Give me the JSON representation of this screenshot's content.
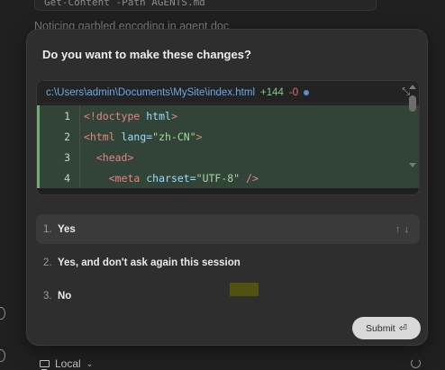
{
  "background": {
    "command_text": "Get-Content -Path AGENTS.md",
    "note_text": "Noticing garbled encoding in agent doc"
  },
  "dialog": {
    "title": "Do you want to make these changes?",
    "file": {
      "path": "c:\\Users\\admin\\Documents\\MySite\\index.html",
      "additions": "+144",
      "deletions": "-0"
    },
    "code_lines": [
      {
        "num": "1",
        "tag_open": "<!doctype",
        "attr": " html",
        "str": "",
        "close": ">",
        "indent": ""
      },
      {
        "num": "2",
        "tag_open": "<html",
        "attr": " lang=",
        "str": "\"zh-CN\"",
        "close": ">",
        "indent": ""
      },
      {
        "num": "3",
        "tag_open": "<head",
        "attr": "",
        "str": "",
        "close": ">",
        "indent": "  "
      },
      {
        "num": "4",
        "tag_open": "<meta",
        "attr": " charset=",
        "str": "\"UTF-8\"",
        "close": " />",
        "indent": "    "
      }
    ],
    "options": [
      {
        "number": "1.",
        "label": "Yes",
        "selected": true
      },
      {
        "number": "2.",
        "label": "Yes, and don't ask again this session",
        "selected": false
      },
      {
        "number": "3.",
        "label": "No",
        "selected": false
      }
    ],
    "nav_arrows": "↑↓",
    "submit_label": "Submit",
    "submit_icon": "⏎"
  },
  "bottom_bar": {
    "environment_label": "Local",
    "chevron": "⌄"
  },
  "colors": {
    "accent_add": "#7fc98a",
    "accent_del": "#e06c75",
    "path_link": "#6aa9e6",
    "diff_added_bg": "#314437"
  }
}
